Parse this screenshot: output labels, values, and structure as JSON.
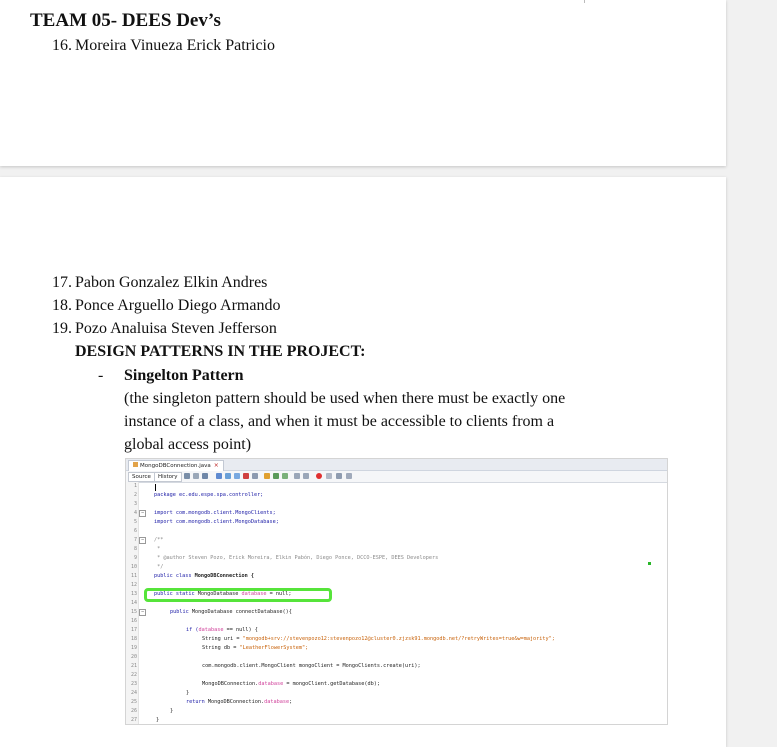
{
  "page1": {
    "team_title": "TEAM 05- DEES Dev’s",
    "members": [
      {
        "num": "16.",
        "name": "Moreira Vinueza Erick Patricio"
      }
    ]
  },
  "page2": {
    "members": [
      {
        "num": "17.",
        "name": "Pabon Gonzalez Elkin Andres"
      },
      {
        "num": "18.",
        "name": "Ponce Arguello Diego Armando"
      },
      {
        "num": "19.",
        "name": "Pozo Analuisa Steven Jefferson"
      }
    ],
    "section_heading": "DESIGN PATTERNS IN THE PROJECT:",
    "bullet_symbol": "-",
    "pattern_name": "Singelton Pattern",
    "pattern_description": [
      "(the singleton pattern should be used when there must be exactly one",
      "instance of a class, and when it must be accessible to clients from a",
      "global access point)"
    ]
  },
  "ide": {
    "tab_label": "MongoDBConnection.java",
    "tab_close": "×",
    "source_label": "Source",
    "history_label": "History",
    "code": {
      "ln1": "1",
      "ln2": "2",
      "l2": "package ec.edu.espe.spa.controller;",
      "ln3": "3",
      "ln4": "4",
      "l4": "import com.mongodb.client.MongoClients;",
      "ln5": "5",
      "l5": "import com.mongodb.client.MongoDatabase;",
      "ln6": "6",
      "ln7": "7",
      "l7": "/**",
      "ln8": "8",
      "l8": " *",
      "ln9": "9",
      "l9": " * @author Steven Pozo, Erick Moreira, Elkin Pabón, Diego Ponce, DCCO-ESPE, DEES Developers",
      "ln10": "10",
      "l10": " */",
      "ln11": "11",
      "l11a": "public class ",
      "l11b": "MongoDBConnection {",
      "ln12": "12",
      "ln13": "13",
      "l13a": "public static ",
      "l13b": "MongoDatabase ",
      "l13c": "database",
      "l13d": " = null;",
      "ln14": "14",
      "ln15": "15",
      "l15a": "public ",
      "l15b": "MongoDatabase connectDatabase(){",
      "ln16": "16",
      "ln17": "17",
      "l17a": "if (",
      "l17b": "database",
      "l17c": " == null) {",
      "ln18": "18",
      "l18a": "String uri = ",
      "l18b": "\"mongodb+srv://stevenpozo12:stevenpozo12@cluster0.zjzsk91.mongodb.net/?retryWrites=true&w=majority\";",
      "ln19": "19",
      "l19a": "String db = ",
      "l19b": "\"LeatherFlowerSystem\";",
      "ln20": "20",
      "ln21": "21",
      "l21": "com.mongodb.client.MongoClient mongoClient = MongoClients.create(uri);",
      "ln22": "22",
      "ln23": "23",
      "l23a": "MongoDBConnection.",
      "l23b": "database",
      "l23c": " = mongoClient.getDatabase(db);",
      "ln24": "24",
      "l24": "}",
      "ln25": "25",
      "l25a": "return ",
      "l25b": "MongoDBConnection.",
      "l25c": "database",
      "l25d": ";",
      "ln26": "26",
      "l26": "}",
      "ln27": "27",
      "l27": "}"
    },
    "fold_minus": "−",
    "colors": {
      "highlight": "#56e43a",
      "keyword": "#1a1aa6",
      "string": "#c8620a",
      "field": "#0f8d3a"
    }
  }
}
